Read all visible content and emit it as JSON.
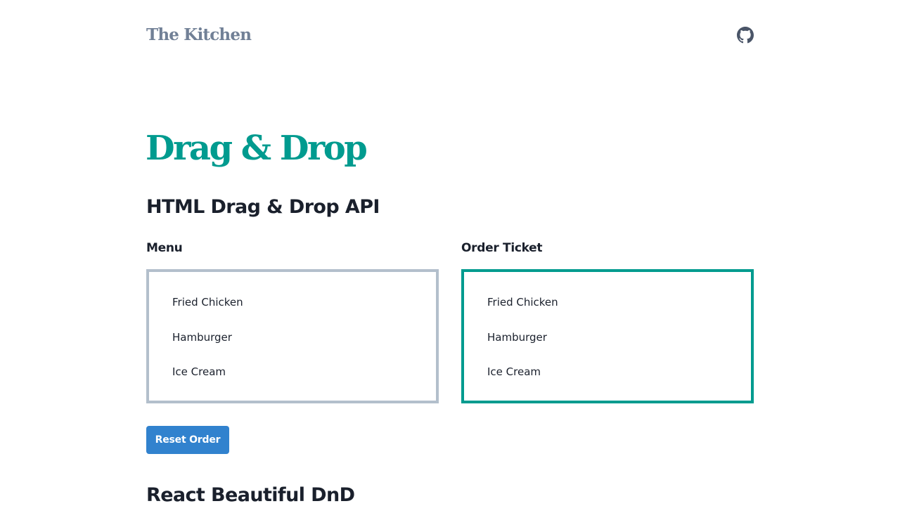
{
  "header": {
    "site_title": "The Kitchen",
    "github_icon": "github-icon"
  },
  "page": {
    "title": "Drag & Drop"
  },
  "sections": [
    {
      "heading": "HTML Drag & Drop API"
    },
    {
      "heading": "React Beautiful DnD"
    }
  ],
  "menu": {
    "label": "Menu",
    "items": [
      "Fried Chicken",
      "Hamburger",
      "Ice Cream"
    ]
  },
  "order_ticket": {
    "label": "Order Ticket",
    "items": [
      "Fried Chicken",
      "Hamburger",
      "Ice Cream"
    ]
  },
  "reset_button": {
    "label": "Reset Order"
  },
  "colors": {
    "accent_teal": "#009b8f",
    "button_blue": "#3182ce",
    "menu_border": "#b3bfcc",
    "muted_title": "#718096"
  }
}
